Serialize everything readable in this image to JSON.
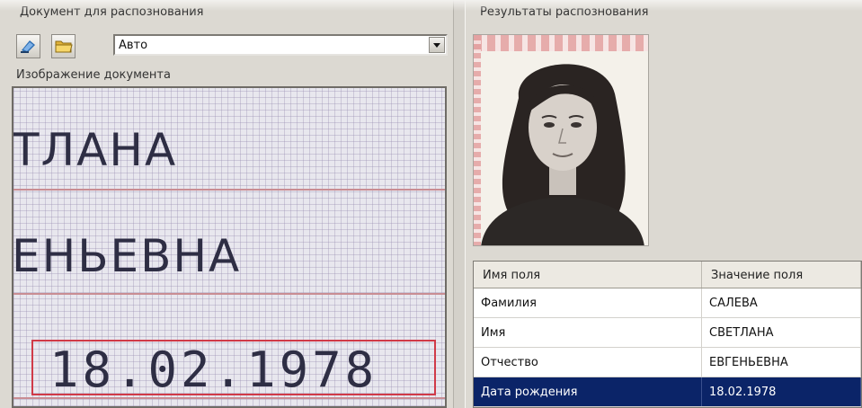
{
  "left_panel": {
    "group_title": "Документ для распознования",
    "buttons": [
      {
        "name": "scan-button",
        "icon": "scanner-icon"
      },
      {
        "name": "open-folder-button",
        "icon": "folder-icon"
      }
    ],
    "mode_select": {
      "value": "Авто"
    },
    "image_label": "Изображение документа",
    "document_image": {
      "line1": "ТЛАНА",
      "line2": "ЕНЬЕВНА",
      "date": "18.02.1978"
    }
  },
  "right_panel": {
    "group_title": "Результаты распознования",
    "photo": {
      "icon": "portrait-photo"
    },
    "table": {
      "headers": [
        "Имя поля",
        "Значение поля"
      ],
      "rows": [
        {
          "field": "Фамилия",
          "value": "САЛЕВА"
        },
        {
          "field": "Имя",
          "value": "СВЕТЛАНА"
        },
        {
          "field": "Отчество",
          "value": "ЕВГЕНЬЕВНА"
        },
        {
          "field": "Дата рождения",
          "value": "18.02.1978",
          "selected": true
        }
      ]
    }
  },
  "colors": {
    "selection": "#0b2468",
    "highlight_box": "#d03a48",
    "background": "#dcd9d2"
  }
}
